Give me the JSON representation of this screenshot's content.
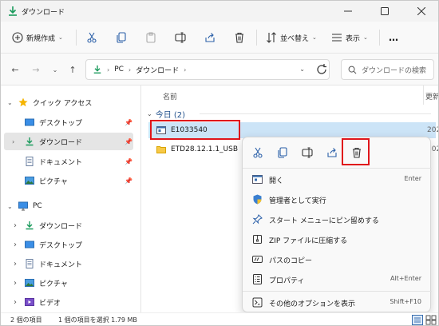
{
  "window": {
    "title": "ダウンロード"
  },
  "commandbar": {
    "new_label": "新規作成",
    "sort_label": "並べ替え",
    "view_label": "表示",
    "more_label": "…"
  },
  "address": {
    "segments": [
      "PC",
      "ダウンロード"
    ],
    "search_placeholder": "ダウンロードの検索"
  },
  "nav": {
    "quick_access": "クイック アクセス",
    "quick_items": [
      "デスクトップ",
      "ダウンロード",
      "ドキュメント",
      "ピクチャ"
    ],
    "pc": "PC",
    "pc_items": [
      "ダウンロード",
      "デスクトップ",
      "ドキュメント",
      "ピクチャ",
      "ビデオ"
    ]
  },
  "content": {
    "column_name": "名前",
    "column_date": "更新",
    "group_label": "今日 (2)",
    "files": [
      {
        "name": "E1033540",
        "date": "202"
      },
      {
        "name": "ETD28.12.1.1_USB",
        "date": "202"
      }
    ]
  },
  "context_menu": {
    "items": [
      {
        "label": "開く",
        "shortcut": "Enter"
      },
      {
        "label": "管理者として実行",
        "shortcut": ""
      },
      {
        "label": "スタート メニューにピン留めする",
        "shortcut": ""
      },
      {
        "label": "ZIP ファイルに圧縮する",
        "shortcut": ""
      },
      {
        "label": "パスのコピー",
        "shortcut": ""
      },
      {
        "label": "プロパティ",
        "shortcut": "Alt+Enter"
      }
    ],
    "more_options": {
      "label": "その他のオプションを表示",
      "shortcut": "Shift+F10"
    }
  },
  "status": {
    "count": "2 個の項目",
    "selection": "1 個の項目を選択  1.79 MB"
  },
  "colors": {
    "accent": "#0067c0",
    "highlight": "#e0161b",
    "selected": "#cce4f7"
  }
}
